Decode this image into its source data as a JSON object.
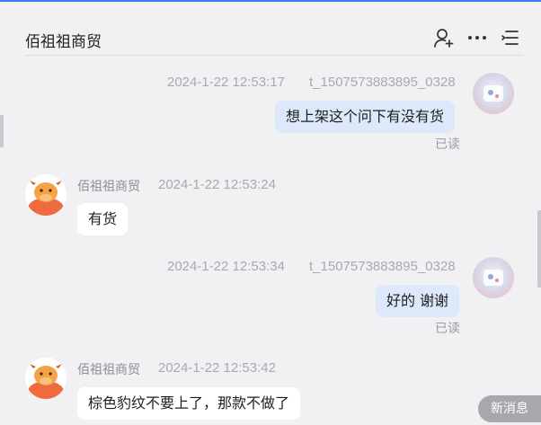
{
  "header": {
    "title": "佰祖祖商贸",
    "icons": [
      "add-user-icon",
      "more-icon",
      "menu-icon"
    ]
  },
  "messages": [
    {
      "sender": "self",
      "name": "t_1507573883895_0328",
      "time": "2024-1-22 12:53:17",
      "text": "想上架这个问下有没有货",
      "status": "已读"
    },
    {
      "sender": "other",
      "name": "佰祖祖商贸",
      "time": "2024-1-22 12:53:24",
      "text": "有货"
    },
    {
      "sender": "self",
      "name": "t_1507573883895_0328",
      "time": "2024-1-22 12:53:34",
      "text": "好的 谢谢",
      "status": "已读"
    },
    {
      "sender": "other",
      "name": "佰祖祖商贸",
      "time": "2024-1-22 12:53:42",
      "text": "棕色豹纹不要上了，那款不做了"
    }
  ],
  "new_message_button": "新消息",
  "colors": {
    "accent": "#3b7cf5",
    "self_bubble": "#dde8fb",
    "other_bubble": "#ffffff",
    "background": "#f1f1f4"
  }
}
